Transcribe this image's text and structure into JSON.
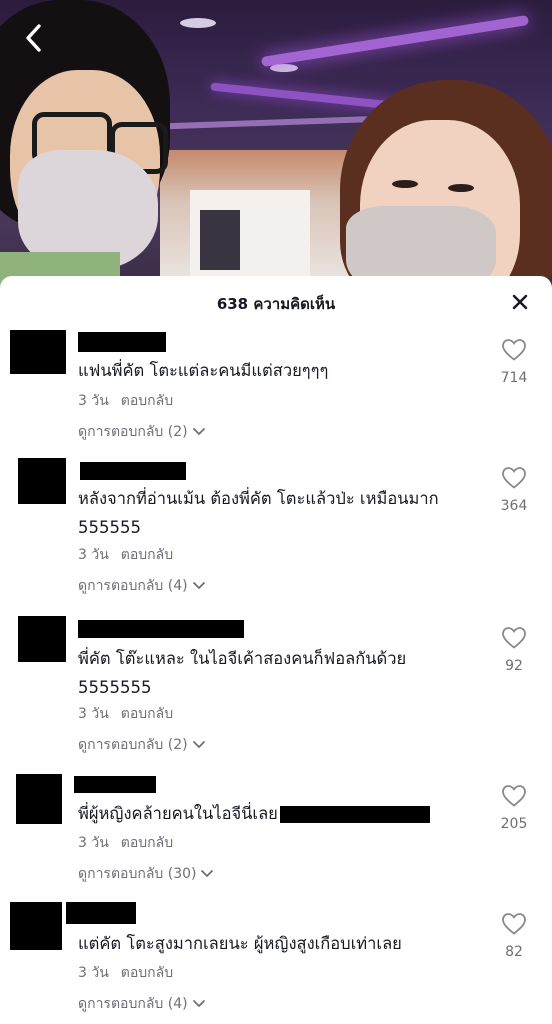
{
  "header": {
    "comment_count_label": "638 ความคิดเห็น"
  },
  "comments": [
    {
      "text": "แฟนพี่คัต โตะแต่ละคนมีแต่สวยๆๆๆ",
      "text2": "",
      "time": "3 วัน",
      "reply": "ตอบกลับ",
      "view_replies": "ดูการตอบกลับ (2)",
      "likes": "714"
    },
    {
      "text": "หลังจากที่อ่านเม้น ต้องพี่คัต โตะแล้วป่ะ เหมือนมาก",
      "text2": "555555",
      "time": "3 วัน",
      "reply": "ตอบกลับ",
      "view_replies": "ดูการตอบกลับ (4)",
      "likes": "364"
    },
    {
      "text": "พี่คัต โต๊ะแหละ ในไอจีเค้าสองคนก็ฟอลกันด้วย",
      "text2": "5555555",
      "time": "3 วัน",
      "reply": "ตอบกลับ",
      "view_replies": "ดูการตอบกลับ (2)",
      "likes": "92"
    },
    {
      "text": "พี่ผู้หญิงคล้ายคนในไอจีนี่เลย",
      "text2": "",
      "time": "3 วัน",
      "reply": "ตอบกลับ",
      "view_replies": "ดูการตอบกลับ (30)",
      "likes": "205"
    },
    {
      "text": "แต่คัต โตะสูงมากเลยนะ ผู้หญิงสูงเกือบเท่าเลย",
      "text2": "",
      "time": "3 วัน",
      "reply": "ตอบกลับ",
      "view_replies": "ดูการตอบกลับ (4)",
      "likes": "82"
    }
  ],
  "icons": {
    "back": "chevron-left-icon",
    "close": "close-icon",
    "like": "heart-outline-icon",
    "expand": "chevron-down-icon"
  },
  "colors": {
    "text_primary": "#161823",
    "text_secondary": "#6f7077",
    "sheet_bg": "#ffffff"
  }
}
